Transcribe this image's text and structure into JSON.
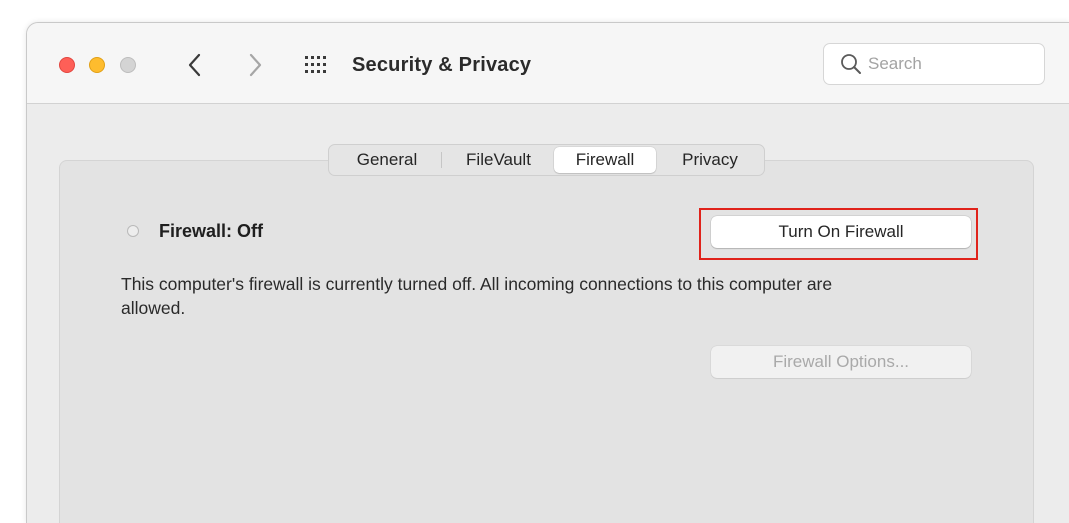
{
  "window": {
    "title": "Security & Privacy"
  },
  "toolbar": {
    "back_icon": "chevron-left-icon",
    "forward_icon": "chevron-right-icon",
    "show_all_icon": "grid-icon"
  },
  "search": {
    "placeholder": "Search",
    "icon": "magnifying-glass-icon"
  },
  "tabs": [
    {
      "label": "General",
      "selected": false
    },
    {
      "label": "FileVault",
      "selected": false
    },
    {
      "label": "Firewall",
      "selected": true
    },
    {
      "label": "Privacy",
      "selected": false
    }
  ],
  "firewall": {
    "status_label": "Firewall: Off",
    "turn_on_button": "Turn On Firewall",
    "description": "This computer's firewall is currently turned off. All incoming connections to this computer are allowed.",
    "options_button": "Firewall Options...",
    "options_enabled": false
  },
  "colors": {
    "close": "#fe5f57",
    "minimize": "#febc2e",
    "zoom_inactive": "#d4d4d4",
    "highlight": "#e0231b"
  }
}
